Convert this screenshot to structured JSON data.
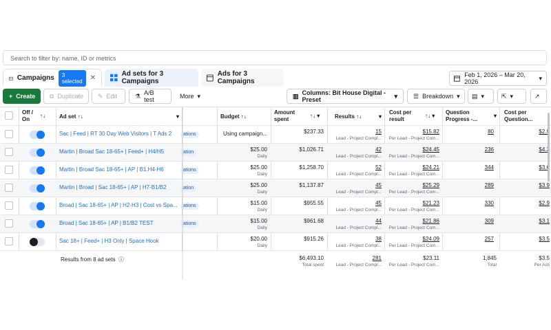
{
  "search": {
    "placeholder": "Search to filter by: name, ID or metrics"
  },
  "tabs": {
    "campaigns": {
      "label": "Campaigns",
      "badge": "3 selected",
      "close": "✕"
    },
    "adsets": {
      "label": "Ad sets for 3 Campaigns"
    },
    "ads": {
      "label": "Ads for 3 Campaigns"
    }
  },
  "date_range": "Feb 1, 2026 – Mar 20, 2026",
  "toolbar": {
    "create": "Create",
    "duplicate": "Duplicate",
    "edit": "Edit",
    "ab_test": "A/B test",
    "more": "More",
    "columns": "Columns: Bit House Digital - Preset",
    "breakdown": "Breakdown"
  },
  "headers": {
    "onoff": "Off / On",
    "adset": "Ad set",
    "budget": "Budget",
    "amount": "Amount spent",
    "results": "Results",
    "cpr": "Cost per result",
    "qp": "Question Progress -...",
    "cpq": "Cost per Question..."
  },
  "rows": [
    {
      "on": true,
      "name": "Sac | Feed | RT 30 Day Web Visitors | T Ads 2",
      "pill": "ations",
      "budget": "Using campaign...",
      "budget_sub": "",
      "amount": "$237.33",
      "results": "15",
      "results_sub": "Lead - Project Compl...",
      "cpr": "$15.82",
      "cpr_sub": "Per Lead - Project Com...",
      "qp": "80",
      "cpq": "$2.9"
    },
    {
      "on": true,
      "name": "Martin | Broad Sac 18-65+ | Feed+ | H4/H5",
      "pill": "ation",
      "budget": "$25.00",
      "budget_sub": "Daily",
      "amount": "$1,026.71",
      "results": "42",
      "results_sub": "Lead - Project Compl...",
      "cpr": "$24.45",
      "cpr_sub": "Per Lead - Project Com...",
      "qp": "236",
      "cpq": "$4.3"
    },
    {
      "on": true,
      "name": "Martin | Broad Sac 18-65+ | AP | B1.H4-H6",
      "pill": "ations",
      "budget": "$25.00",
      "budget_sub": "Daily",
      "amount": "$1,258.70",
      "results": "52",
      "results_sub": "Lead - Project Compl...",
      "cpr": "$24.21",
      "cpr_sub": "Per Lead - Project Com...",
      "qp": "344",
      "cpq": "$3.6"
    },
    {
      "on": true,
      "name": "Martin | Broad | Sac 18-65+ | AP | H7-B1/B2",
      "pill": "ation",
      "budget": "$25.00",
      "budget_sub": "Daily",
      "amount": "$1,137.87",
      "results": "45",
      "results_sub": "Lead - Project Compl...",
      "cpr": "$25.29",
      "cpr_sub": "Per Lead - Project Com...",
      "qp": "289",
      "cpq": "$3.9"
    },
    {
      "on": true,
      "name": "Broad | Sac 18-65+ | AP | H2-H3 | Cost vs Spa...",
      "pill": "ations",
      "budget": "$15.00",
      "budget_sub": "Daily",
      "amount": "$955.55",
      "results": "45",
      "results_sub": "Lead - Project Compl...",
      "cpr": "$21.23",
      "cpr_sub": "Per Lead - Project Com...",
      "qp": "330",
      "cpq": "$2.9"
    },
    {
      "on": true,
      "name": "Broad | Sac 18-65+ | AP | B1/B2 TEST",
      "pill": "ations",
      "budget": "$15.00",
      "budget_sub": "Daily",
      "amount": "$961.68",
      "results": "44",
      "results_sub": "Lead - Project Compl...",
      "cpr": "$21.86",
      "cpr_sub": "Per Lead - Project Com...",
      "qp": "309",
      "cpq": "$3.1"
    },
    {
      "on": false,
      "name": "Sac 18+ | Feed+ | H3 Only | Space Hook",
      "pill": "",
      "budget": "$20.00",
      "budget_sub": "Daily",
      "amount": "$915.26",
      "results": "38",
      "results_sub": "Lead - Project Compl...",
      "cpr": "$24.09",
      "cpr_sub": "Per Lead - Project Com...",
      "qp": "257",
      "cpq": "$3.5"
    }
  ],
  "totals": {
    "label": "Results from 8 ad sets",
    "amount": "$6,493.10",
    "amount_sub": "Total spent",
    "results": "281",
    "results_sub": "Lead - Project Compl...",
    "cpr": "$23.11",
    "cpr_sub": "Per Lead - Project Com...",
    "qp": "1,845",
    "qp_sub": "Total",
    "cpq": "$3.5",
    "cpq_sub": "Per Acti"
  },
  "colors": {
    "accent": "#1877f2",
    "create": "#1a7a3c",
    "link": "#216fdb"
  }
}
